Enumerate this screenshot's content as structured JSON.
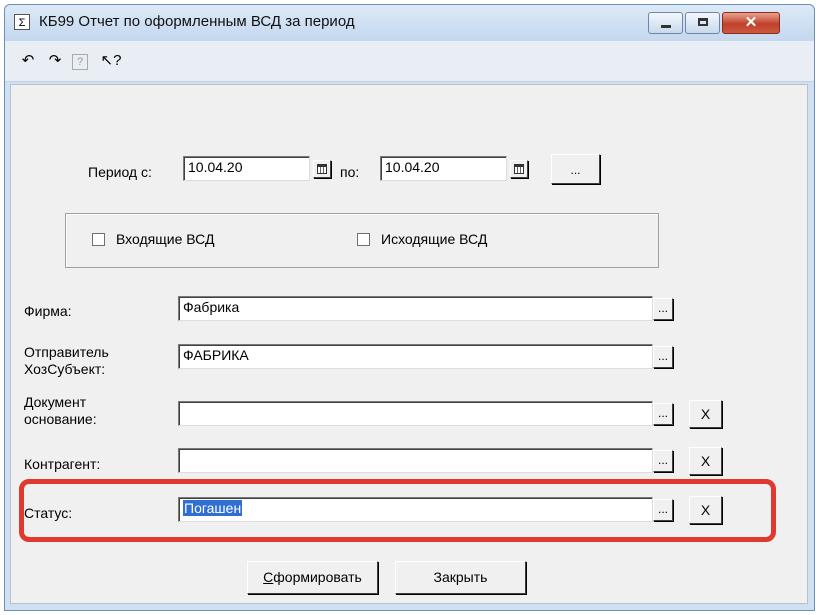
{
  "window": {
    "title": "КБ99 Отчет по оформленным ВСД за период",
    "icon_glyph": "Σ",
    "controls": {
      "minimize": "minimize-icon",
      "maximize": "maximize-icon",
      "close": "close-icon",
      "close_glyph": "✕"
    }
  },
  "toolbar": {
    "icons": [
      "undo-icon",
      "redo-icon",
      "help-icon",
      "context-help-icon"
    ],
    "glyphs": [
      "↶",
      "↷",
      "?",
      "↖?"
    ]
  },
  "period": {
    "from_label": "Период с:",
    "from_value": "10.04.20",
    "to_label": "по:",
    "to_value": "10.04.20",
    "more_label": "..."
  },
  "vsd": {
    "incoming_label": "Входящие ВСД",
    "incoming_checked": false,
    "outgoing_label": "Исходящие ВСД",
    "outgoing_checked": false
  },
  "fields": {
    "firm_label": "Фирма:",
    "firm_value": "Фабрика",
    "sender_label_line1": "Отправитель",
    "sender_label_line2": "ХозСубъект:",
    "sender_value": "ФАБРИКА",
    "document_label_line1": "Документ",
    "document_label_line2": "основание:",
    "document_value": "",
    "counterparty_label": "Контрагент:",
    "counterparty_value": "",
    "status_label": "Статус:",
    "status_value": "Погашен",
    "select_label": "...",
    "clear_label": "X"
  },
  "buttons": {
    "generate_label": "Сформировать",
    "generate_accel": "С",
    "generate_rest": "формировать",
    "close_label": "Закрыть"
  },
  "colors": {
    "highlight": "#e03a30",
    "selection": "#2f6fd1"
  }
}
